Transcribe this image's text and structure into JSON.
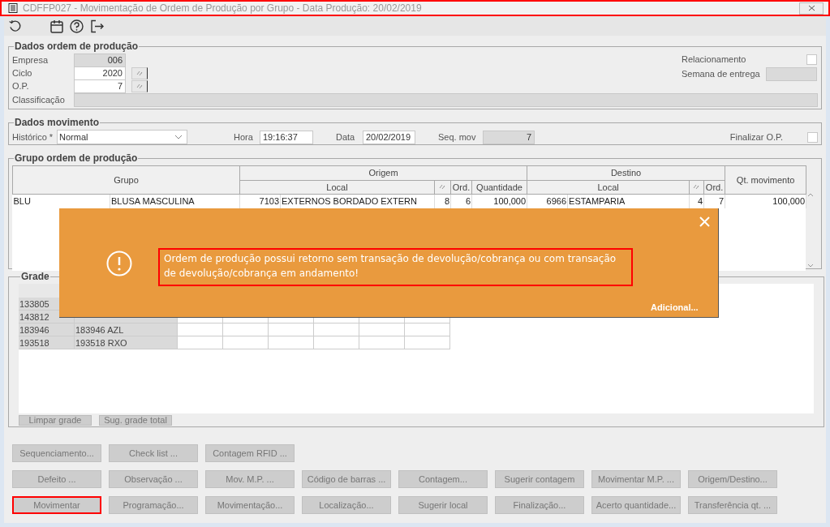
{
  "window": {
    "title": "CDFFP027 - Movimentação de Ordem de Produção por Grupo - Data Produção: 20/02/2019",
    "highlighted": true
  },
  "dados_ordem": {
    "title": "Dados ordem de produção",
    "fields": [
      {
        "label": "Empresa",
        "value": "006",
        "disabled": true,
        "lookup": false
      },
      {
        "label": "Ciclo",
        "value": "2020",
        "disabled": false,
        "lookup": true
      },
      {
        "label": "O.P.",
        "value": "7",
        "disabled": false,
        "lookup": true
      }
    ],
    "relacionamento": {
      "label": "Relacionamento",
      "checked": false
    },
    "semana": {
      "label": "Semana de entrega",
      "disabled": true
    },
    "classificacao": {
      "label": "Classificação",
      "disabled": true
    }
  },
  "dados_movimento": {
    "title": "Dados movimento",
    "historico": {
      "label": "Histórico *",
      "value": "Normal"
    },
    "hora": {
      "label": "Hora",
      "value": "19:16:37"
    },
    "data": {
      "label": "Data",
      "value": "20/02/2019"
    },
    "seq_mov": {
      "label": "Seq. mov",
      "value": "7",
      "disabled": true
    },
    "finalizar": {
      "label": "Finalizar O.P.",
      "checked": false
    }
  },
  "grupo": {
    "title": "Grupo ordem de produção",
    "header": {
      "grupo": "Grupo",
      "qt_movimento": "Qt. movimento",
      "origem": {
        "label": "Origem",
        "local": "Local",
        "ord": "Ord.",
        "quantidade": "Quantidade"
      },
      "destino": {
        "label": "Destino",
        "local": "Local",
        "ord": "Ord."
      }
    },
    "rows": [
      {
        "cells": [
          "BLU",
          "BLUSA MASCULINA",
          "7103",
          "EXTERNOS BORDADO EXTERN",
          "8",
          "6",
          "100,000",
          "6966",
          "ESTAMPARIA",
          "4",
          "7",
          "100,000"
        ]
      }
    ]
  },
  "grade": {
    "title": "Grade",
    "rows": [
      {
        "code": "133805"
      },
      {
        "code": "143812"
      },
      {
        "code": "183946",
        "name": "183946 AZL"
      },
      {
        "code": "193518",
        "name": "193518 RXO"
      }
    ],
    "buttons": [
      "Limpar grade",
      "Sug. grade total"
    ]
  },
  "buttons": [
    [
      {
        "label": "Sequenciamento...",
        "highlighted": false
      },
      {
        "label": "Check list ...",
        "highlighted": false
      },
      {
        "label": "Contagem RFID ...",
        "highlighted": false
      }
    ],
    [
      {
        "label": "Defeito ...",
        "highlighted": false
      },
      {
        "label": "Observação ...",
        "highlighted": false
      },
      {
        "label": "Mov. M.P. ...",
        "highlighted": false
      },
      {
        "label": "Código de barras ...",
        "highlighted": false
      },
      {
        "label": "Contagem...",
        "highlighted": false
      },
      {
        "label": "Sugerir contagem",
        "highlighted": false
      },
      {
        "label": "Movimentar M.P. ...",
        "highlighted": false
      },
      {
        "label": "Origem/Destino...",
        "highlighted": false
      }
    ],
    [
      {
        "label": "Movimentar",
        "highlighted": true
      },
      {
        "label": "Programação...",
        "highlighted": false
      },
      {
        "label": "Movimentação...",
        "highlighted": false
      },
      {
        "label": "Localização...",
        "highlighted": false
      },
      {
        "label": "Sugerir local",
        "highlighted": false
      },
      {
        "label": "Finalização...",
        "highlighted": false
      },
      {
        "label": "Acerto quantidade...",
        "highlighted": false
      },
      {
        "label": "Transferência qt. ...",
        "highlighted": false
      }
    ]
  ],
  "toast": {
    "message": "Ordem de produção possui retorno sem transação de devolução/cobrança ou com transação de devolução/cobrança em andamento!",
    "highlighted": true,
    "link": "Adicional..."
  }
}
